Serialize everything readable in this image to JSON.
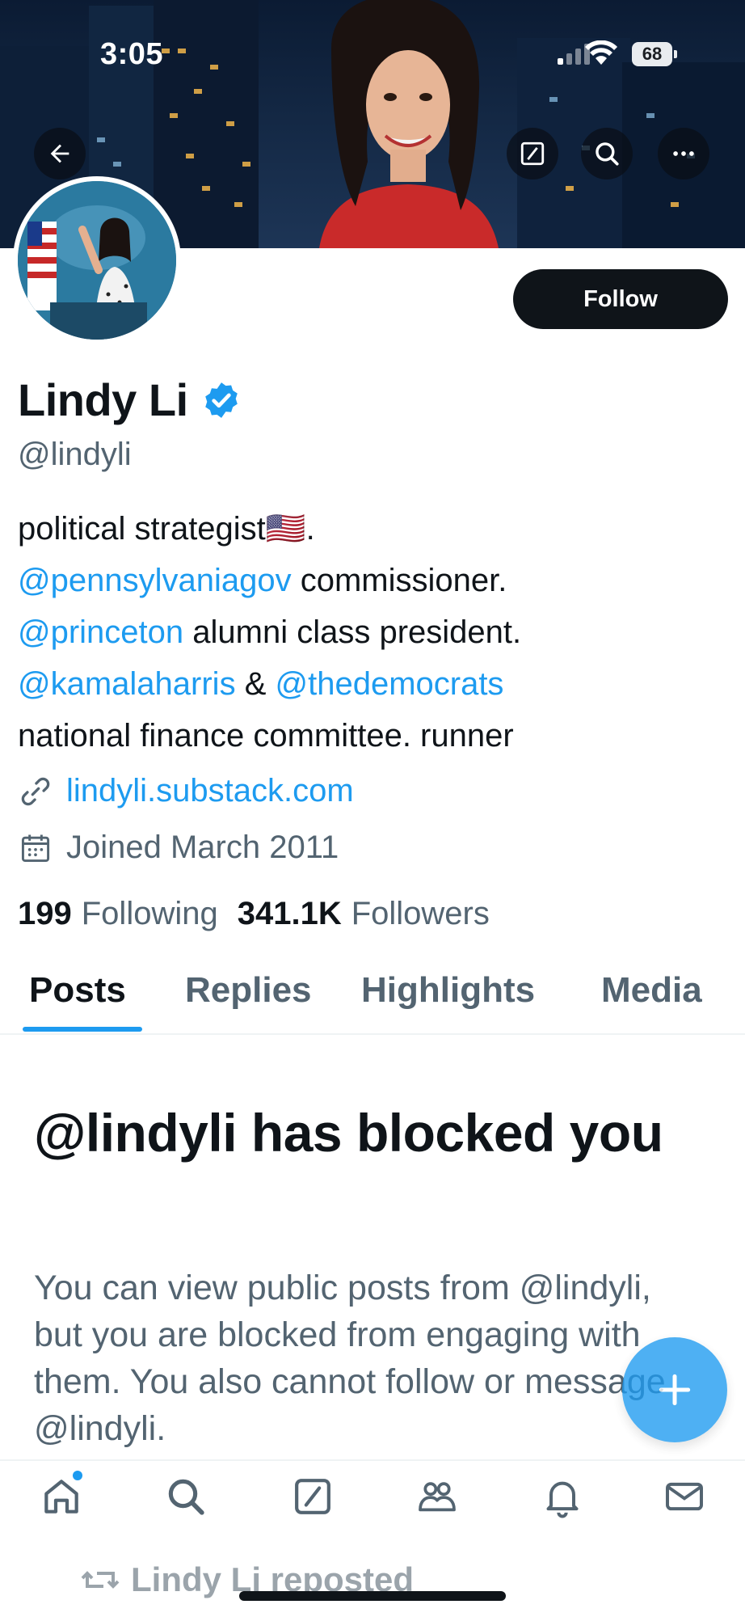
{
  "status_bar": {
    "time": "3:05",
    "battery": "68"
  },
  "profile": {
    "name": "Lindy Li",
    "handle": "@lindyli",
    "follow_label": "Follow",
    "bio": {
      "line1_text": "political strategist",
      "line1_flag": "🇺🇸",
      "line1_end": ".",
      "line2_mention": "@pennsylvaniagov",
      "line2_text": " commissioner.",
      "line3_mention": "@princeton",
      "line3_text": " alumni class president.",
      "line4_mention1": "@kamalaharris",
      "line4_amp": " & ",
      "line4_mention2": "@thedemocrats",
      "line5_text": "national finance committee. runner"
    },
    "website": "lindyli.substack.com",
    "joined": "Joined March 2011",
    "following_count": "199",
    "following_label": "Following",
    "followers_count": "341.1K",
    "followers_label": "Followers"
  },
  "tabs": [
    {
      "label": "Posts",
      "active": true
    },
    {
      "label": "Replies"
    },
    {
      "label": "Highlights"
    },
    {
      "label": "Media"
    }
  ],
  "blocked": {
    "title": "@lindyli has blocked you",
    "body": "You can view public posts from @lindyli, but you are blocked from engaging with them. You also cannot follow or message @lindyli."
  },
  "repost_label": "Lindy Li reposted",
  "colors": {
    "accent": "#1d9bf0",
    "text": "#0f1419",
    "secondary": "#536471"
  },
  "nav_icons": [
    "home-icon",
    "search-icon",
    "grok-icon",
    "communities-icon",
    "notifications-icon",
    "messages-icon"
  ]
}
